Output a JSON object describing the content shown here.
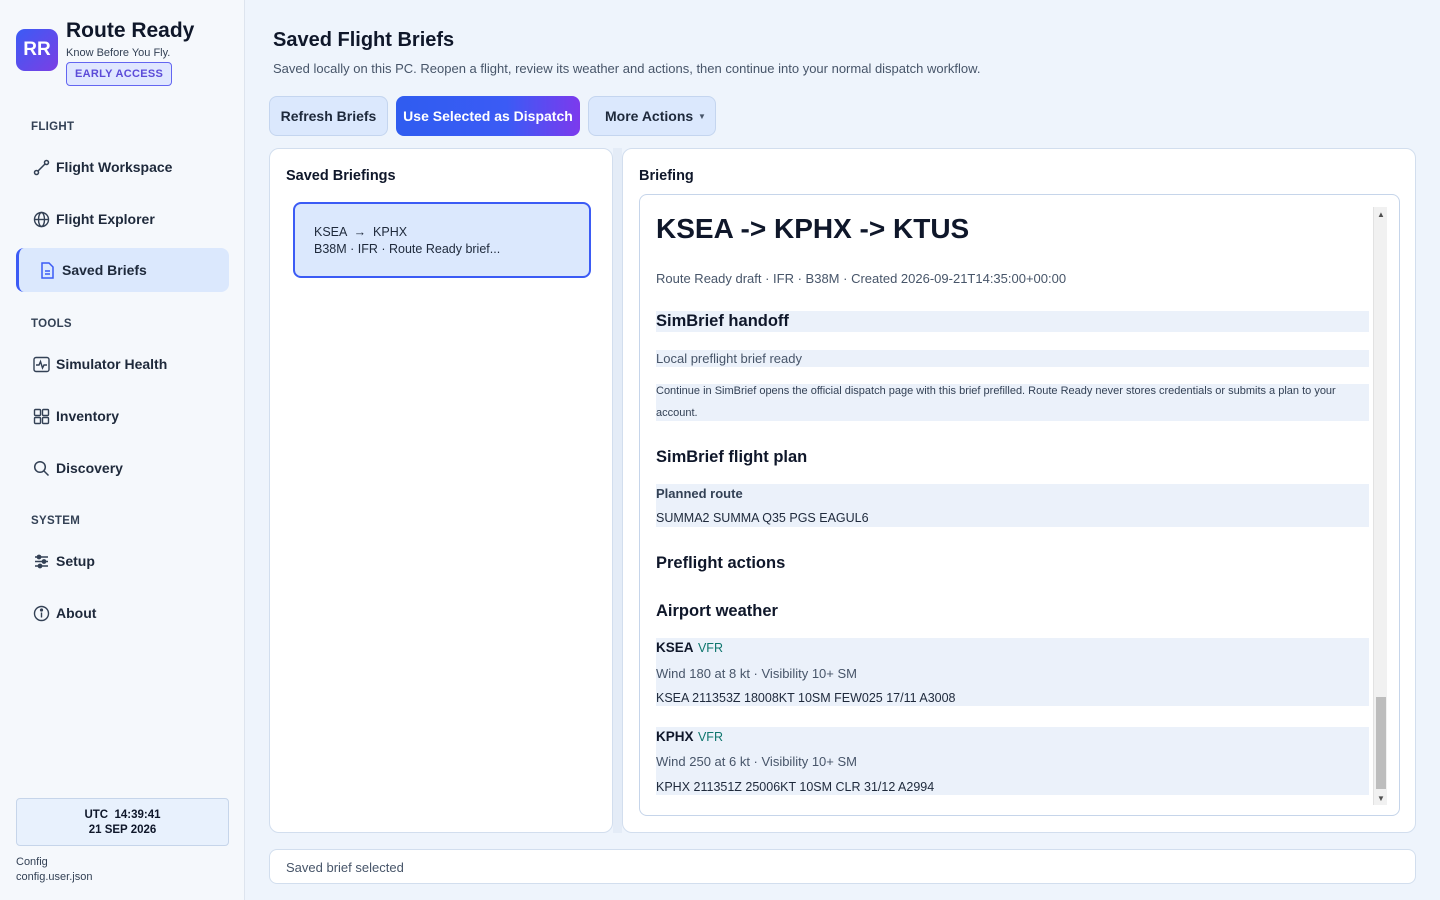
{
  "brand": {
    "initials": "RR",
    "name": "Route Ready",
    "tagline": "Know Before You Fly.",
    "badge": "EARLY ACCESS"
  },
  "sidebar": {
    "sections": [
      "FLIGHT",
      "TOOLS",
      "SYSTEM"
    ],
    "items": [
      {
        "label": "Flight Workspace",
        "icon": "route-icon"
      },
      {
        "label": "Flight Explorer",
        "icon": "globe-icon"
      },
      {
        "label": "Saved Briefs",
        "icon": "document-icon",
        "active": true
      },
      {
        "label": "Simulator Health",
        "icon": "pulse-icon"
      },
      {
        "label": "Inventory",
        "icon": "grid-icon"
      },
      {
        "label": "Discovery",
        "icon": "search-icon"
      },
      {
        "label": "Setup",
        "icon": "sliders-icon"
      },
      {
        "label": "About",
        "icon": "info-icon"
      }
    ],
    "clock": {
      "time": "UTC  14:39:41",
      "date": "21 SEP 2026"
    },
    "config": {
      "label": "Config",
      "file": "config.user.json"
    }
  },
  "page": {
    "title": "Saved Flight Briefs",
    "subtitle": "Saved locally on this PC. Reopen a flight, review its weather and actions, then continue into your normal dispatch workflow."
  },
  "toolbar": {
    "refresh": "Refresh Briefs",
    "dispatch": "Use Selected as Dispatch",
    "more": "More Actions"
  },
  "saved_panel": {
    "title": "Saved Briefings",
    "items": [
      {
        "route": "KSEA  →  KPHX",
        "detail": "B38M · IFR · Route Ready brief..."
      }
    ]
  },
  "briefing": {
    "title": "Briefing",
    "heading": "KSEA -> KPHX -> KTUS",
    "meta": "Route Ready draft · IFR · B38M · Created 2026-09-21T14:35:00+00:00",
    "handoff_title": "SimBrief handoff",
    "handoff_status": "Local preflight brief ready",
    "handoff_note": "Continue in SimBrief opens the official dispatch page with this brief prefilled. Route Ready never stores credentials or submits a plan to your account.",
    "plan_title": "SimBrief flight plan",
    "planned_route_label": "Planned route",
    "planned_route": "SUMMA2 SUMMA Q35 PGS EAGUL6",
    "actions_title": "Preflight actions",
    "weather_title": "Airport weather",
    "weather": [
      {
        "id": "KSEA",
        "category": "VFR",
        "summary": "Wind 180 at 8 kt · Visibility 10+ SM",
        "metar": "KSEA 211353Z 18008KT 10SM FEW025 17/11 A3008"
      },
      {
        "id": "KPHX",
        "category": "VFR",
        "summary": "Wind 250 at 6 kt · Visibility 10+ SM",
        "metar": "KPHX 211351Z 25006KT 10SM CLR 31/12 A2994"
      }
    ]
  },
  "status": "Saved brief selected",
  "colors": {
    "accent": "#3b5bf5",
    "accent_purple": "#7c3aed",
    "selected_bg": "#dbe8fd",
    "vfr": "#0f766e",
    "page_bg": "#eef4fc"
  }
}
